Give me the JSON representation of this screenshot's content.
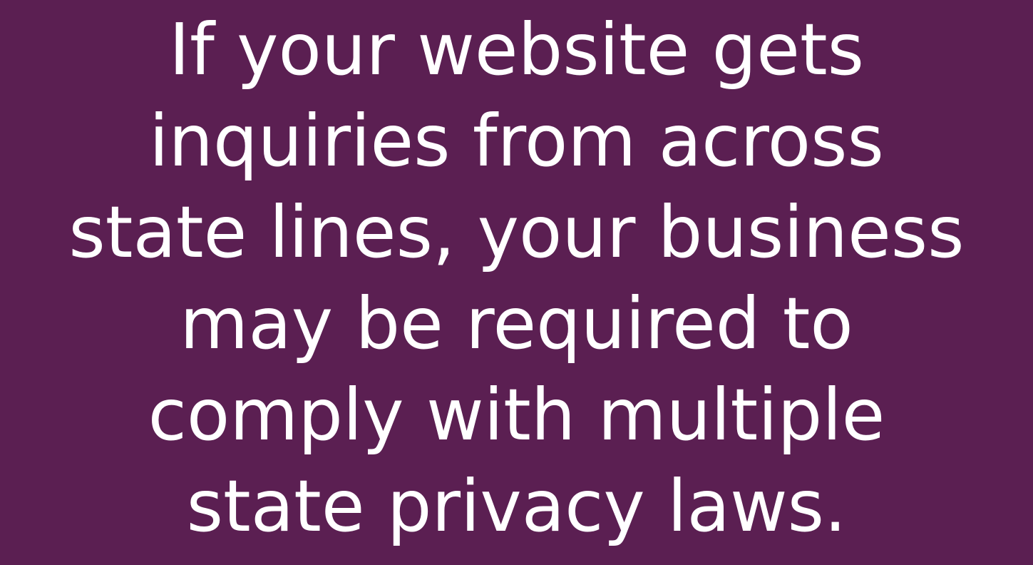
{
  "background_color": "#5b1f52",
  "text_color": "#ffffff",
  "message": {
    "lines": [
      "If your website gets",
      "inquiries from across",
      "state lines, your business",
      "may be required to",
      "comply with multiple",
      "state privacy laws."
    ]
  }
}
